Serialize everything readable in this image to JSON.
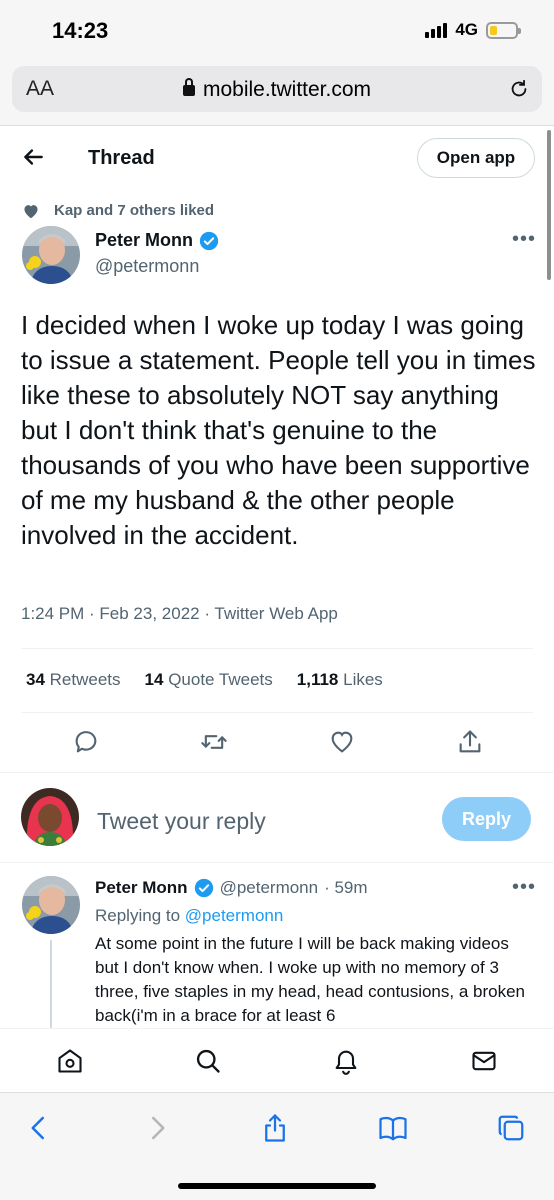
{
  "status_bar": {
    "time": "14:23",
    "network": "4G",
    "battery_level": 0.3,
    "battery_color": "#f7c91a"
  },
  "browser": {
    "aa_label": "AA",
    "url": "mobile.twitter.com"
  },
  "header": {
    "title": "Thread",
    "open_app_label": "Open app"
  },
  "social_context": {
    "text": "Kap and 7 others liked"
  },
  "tweet": {
    "author_name": "Peter Monn",
    "author_handle": "@petermonn",
    "text": "I decided when I woke up today I was going to issue a statement.  People tell you in times like these to absolutely NOT say anything but I don't think that's genuine to the thousands of you who have been supportive of me my husband & the other people involved in the accident.",
    "meta": "1:24 PM · Feb 23, 2022 · Twitter Web App",
    "stats": [
      {
        "count": "34",
        "label": "Retweets"
      },
      {
        "count": "14",
        "label": "Quote Tweets"
      },
      {
        "count": "1,118",
        "label": "Likes"
      }
    ]
  },
  "composer": {
    "placeholder": "Tweet your reply",
    "reply_label": "Reply",
    "reply_color": "#8ecdf8"
  },
  "reply_tweet": {
    "author_name": "Peter Monn",
    "author_handle": "@petermonn",
    "time": "· 59m",
    "replying_prefix": "Replying to",
    "replying_handle": "@petermonn",
    "text": "At some point in the future I will be back making videos but I don't know when.  I woke up with no memory of 3 three, five staples in my head, head contusions, a broken back(i'm in a brace for at least 6"
  },
  "colors": {
    "accent": "#1d9bf0",
    "secondary_text": "#536471"
  }
}
